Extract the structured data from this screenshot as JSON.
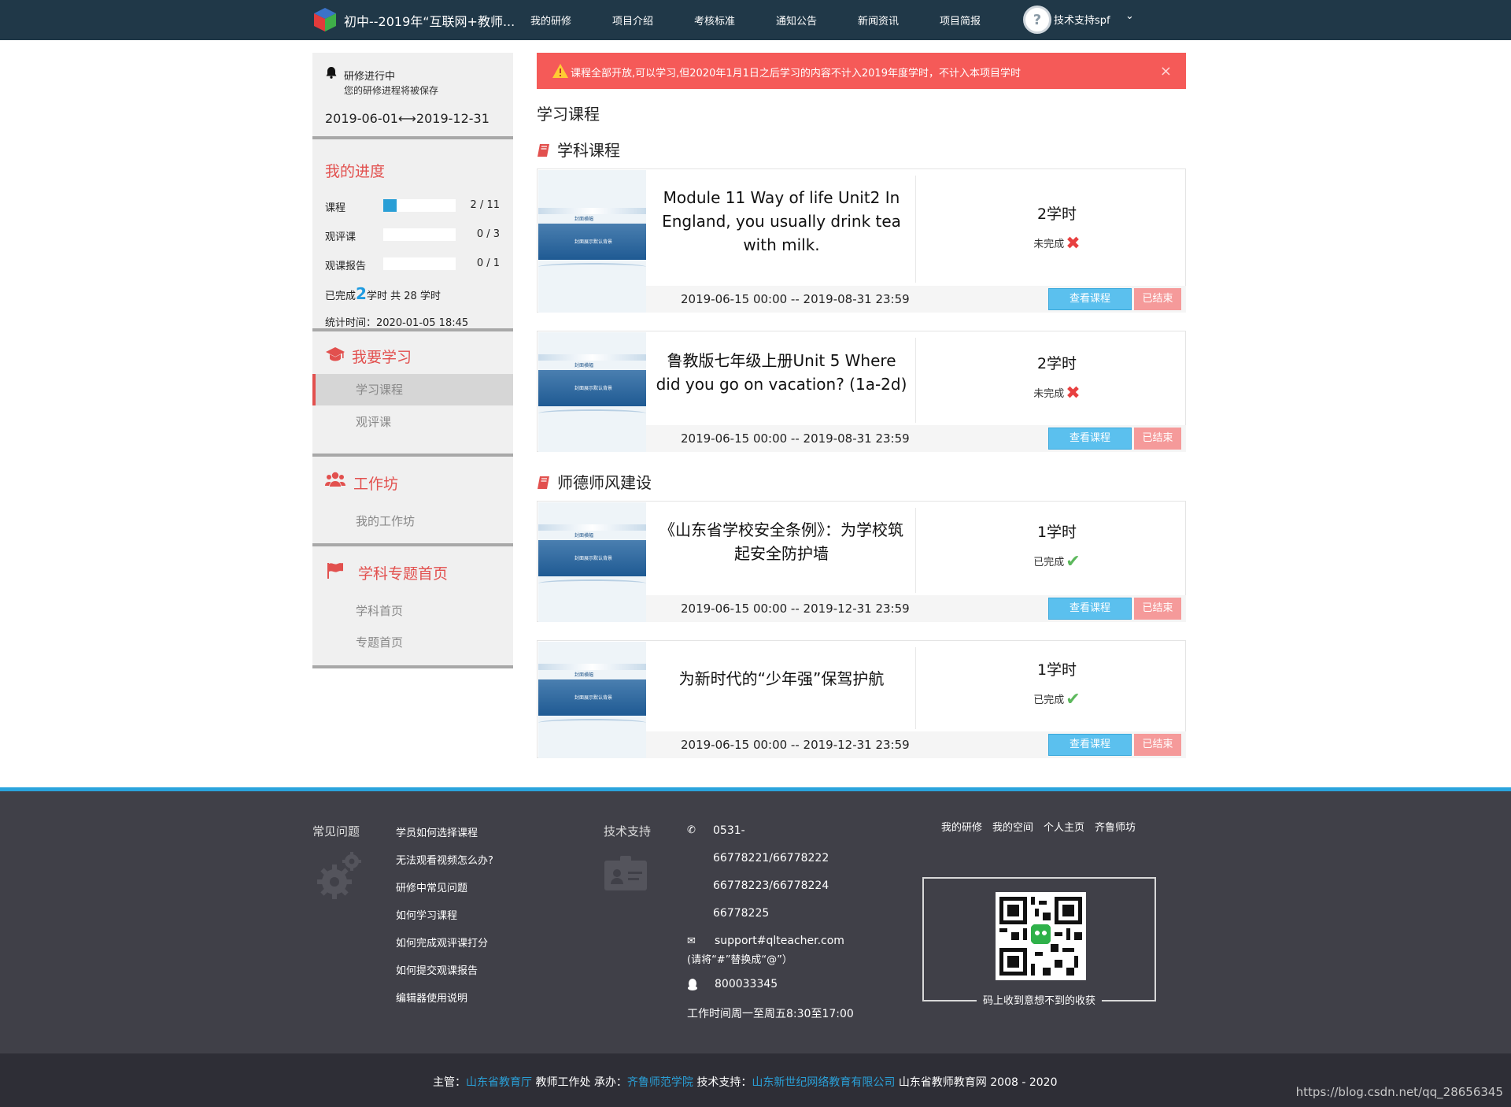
{
  "colors": {
    "nav_bg": "#203848",
    "accent_red": "#e2504e",
    "progress_blue": "#2a9fd6",
    "alert_red": "#f55a58",
    "footer_bg": "#404048",
    "footer_accent": "#2aa4dd"
  },
  "topnav": {
    "logo_icon": "cube-logo-icon",
    "brand": "初中--2019年“互联网+教师...",
    "items": [
      "我的研修",
      "项目介绍",
      "考核标准",
      "通知公告",
      "新闻资讯",
      "项目简报"
    ],
    "user": {
      "avatar_icon": "avatar-icon",
      "name": "技术支持spf",
      "caret_icon": "chevron-down-icon"
    }
  },
  "sidebar": {
    "status": {
      "icon": "bell-icon",
      "title": "研修进行中",
      "subtitle": "您的研修进程将被保存",
      "dates": "2019-06-01⟷2019-12-31"
    },
    "progress": {
      "heading": "我的进度",
      "rows": [
        {
          "label": "课程",
          "done": 2,
          "total": 11,
          "count": "2 / 11"
        },
        {
          "label": "观评课",
          "done": 0,
          "total": 3,
          "count": "0 / 3"
        },
        {
          "label": "观课报告",
          "done": 0,
          "total": 1,
          "count": "0 / 1"
        }
      ],
      "completed_prefix": "已完成",
      "completed_value": "2",
      "completed_suffix": "学时 共 28 学时",
      "stat_time": "统计时间：2020-01-05 18:45"
    },
    "sections": [
      {
        "icon": "graduation-cap-icon",
        "label": "我要学习",
        "links": [
          "学习课程",
          "观评课"
        ],
        "active": 0
      },
      {
        "icon": "users-icon",
        "label": "工作坊",
        "links": [
          "我的工作坊"
        ]
      },
      {
        "icon": "flag-icon",
        "label": "学科专题首页",
        "links": [
          "学科首页",
          "专题首页"
        ]
      }
    ]
  },
  "alert": {
    "icon": "warning-icon",
    "text": "课程全部开放,可以学习,但2020年1月1日之后学习的内容不计入2019年度学时，不计入本项目学时",
    "close": "×"
  },
  "main": {
    "title": "学习课程",
    "categories": [
      {
        "icon": "book-icon",
        "title": "学科课程"
      },
      {
        "icon": "book-icon",
        "title": "师德师风建设"
      }
    ],
    "thumb": {
      "label_top": "封面横幅",
      "label_band": "封面展示默认背景"
    },
    "courses": [
      {
        "title": "Module 11 Way of life Unit2 In England, you usually drink tea with milk.",
        "hours": "2学时",
        "status": "未完成",
        "status_icon": "cross-mark-icon",
        "dates": "2019-06-15 00:00 -- 2019-08-31 23:59",
        "view": "查看课程",
        "ended": "已结束"
      },
      {
        "title": "鲁教版七年级上册Unit 5 Where did you go on vacation? (1a-2d)",
        "hours": "2学时",
        "status": "未完成",
        "status_icon": "cross-mark-icon",
        "dates": "2019-06-15 00:00 -- 2019-08-31 23:59",
        "view": "查看课程",
        "ended": "已结束"
      },
      {
        "title": "《山东省学校安全条例》：为学校筑起安全防护墙",
        "hours": "1学时",
        "status": "已完成",
        "status_icon": "check-mark-icon",
        "dates": "2019-06-15 00:00 -- 2019-12-31 23:59",
        "view": "查看课程",
        "ended": "已结束"
      },
      {
        "title": "为新时代的“少年强”保驾护航",
        "hours": "1学时",
        "status": "已完成",
        "status_icon": "check-mark-icon",
        "dates": "2019-06-15 00:00 -- 2019-12-31 23:59",
        "view": "查看课程",
        "ended": "已结束"
      }
    ]
  },
  "footer": {
    "faq_heading": "常见问题",
    "faq_icon": "gear-icon",
    "faq_links": [
      "学员如何选择课程",
      "无法观看视频怎么办?",
      "研修中常见问题",
      "如何学习课程",
      "如何完成观评课打分",
      "如何提交观课报告",
      "编辑器使用说明"
    ],
    "support_heading": "技术支持",
    "support_icon": "id-card-icon",
    "phone_icon": "phone-icon",
    "phone_lines": [
      "0531-",
      "66778221/66778222",
      "66778223/66778224",
      "66778225"
    ],
    "mail_icon": "envelope-icon",
    "email": "support#qlteacher.com",
    "email_note": "(请将“#”替换成“@”）",
    "qq_icon": "qq-icon",
    "qq": "800033345",
    "hours": "工作时间周一至周五8:30至17:00",
    "top_links": [
      "我的研修",
      "我的空间",
      "个人主页",
      "齐鲁师坊"
    ],
    "qr_icon": "qr-code-icon",
    "qr_caption": "码上收到意想不到的收获"
  },
  "bottombar": {
    "host_label": "主管：",
    "host": "山东省教育厅",
    "org": "教师工作处",
    "undertake_label": "承办：",
    "undertake": "齐鲁师范学院",
    "tech_label": "技术支持：",
    "tech": "山东新世纪网络教育有限公司",
    "copyright": "山东省教师教育网 2008 - 2020",
    "watermark": "https://blog.csdn.net/qq_28656345"
  }
}
